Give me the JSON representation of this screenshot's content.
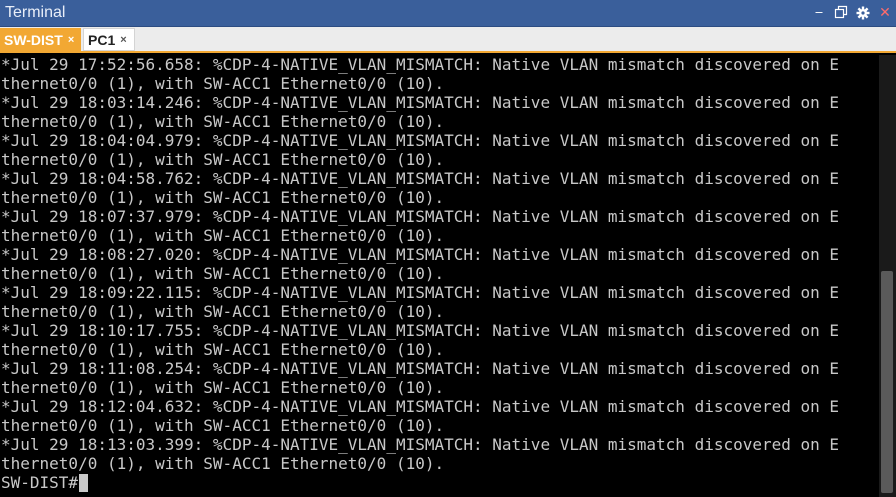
{
  "window": {
    "title": "Terminal"
  },
  "controls": {
    "minimize_glyph": "‒",
    "close_glyph": "✕"
  },
  "tabs": [
    {
      "label": "SW-DIST",
      "close": "×",
      "active": true
    },
    {
      "label": "PC1",
      "close": "×",
      "active": false
    }
  ],
  "colors": {
    "titlebar": "#3a5f9b",
    "active_tab": "#f2a833",
    "terminal_bg": "#000000",
    "terminal_text": "#c8c8c8"
  },
  "console": {
    "lines": [
      "*Jul 29 17:52:56.658: %CDP-4-NATIVE_VLAN_MISMATCH: Native VLAN mismatch discovered on E",
      "thernet0/0 (1), with SW-ACC1 Ethernet0/0 (10).",
      "*Jul 29 18:03:14.246: %CDP-4-NATIVE_VLAN_MISMATCH: Native VLAN mismatch discovered on E",
      "thernet0/0 (1), with SW-ACC1 Ethernet0/0 (10).",
      "*Jul 29 18:04:04.979: %CDP-4-NATIVE_VLAN_MISMATCH: Native VLAN mismatch discovered on E",
      "thernet0/0 (1), with SW-ACC1 Ethernet0/0 (10).",
      "*Jul 29 18:04:58.762: %CDP-4-NATIVE_VLAN_MISMATCH: Native VLAN mismatch discovered on E",
      "thernet0/0 (1), with SW-ACC1 Ethernet0/0 (10).",
      "*Jul 29 18:07:37.979: %CDP-4-NATIVE_VLAN_MISMATCH: Native VLAN mismatch discovered on E",
      "thernet0/0 (1), with SW-ACC1 Ethernet0/0 (10).",
      "*Jul 29 18:08:27.020: %CDP-4-NATIVE_VLAN_MISMATCH: Native VLAN mismatch discovered on E",
      "thernet0/0 (1), with SW-ACC1 Ethernet0/0 (10).",
      "*Jul 29 18:09:22.115: %CDP-4-NATIVE_VLAN_MISMATCH: Native VLAN mismatch discovered on E",
      "thernet0/0 (1), with SW-ACC1 Ethernet0/0 (10).",
      "*Jul 29 18:10:17.755: %CDP-4-NATIVE_VLAN_MISMATCH: Native VLAN mismatch discovered on E",
      "thernet0/0 (1), with SW-ACC1 Ethernet0/0 (10).",
      "*Jul 29 18:11:08.254: %CDP-4-NATIVE_VLAN_MISMATCH: Native VLAN mismatch discovered on E",
      "thernet0/0 (1), with SW-ACC1 Ethernet0/0 (10).",
      "*Jul 29 18:12:04.632: %CDP-4-NATIVE_VLAN_MISMATCH: Native VLAN mismatch discovered on E",
      "thernet0/0 (1), with SW-ACC1 Ethernet0/0 (10).",
      "*Jul 29 18:13:03.399: %CDP-4-NATIVE_VLAN_MISMATCH: Native VLAN mismatch discovered on E",
      "thernet0/0 (1), with SW-ACC1 Ethernet0/0 (10)."
    ],
    "prompt": "SW-DIST#"
  }
}
